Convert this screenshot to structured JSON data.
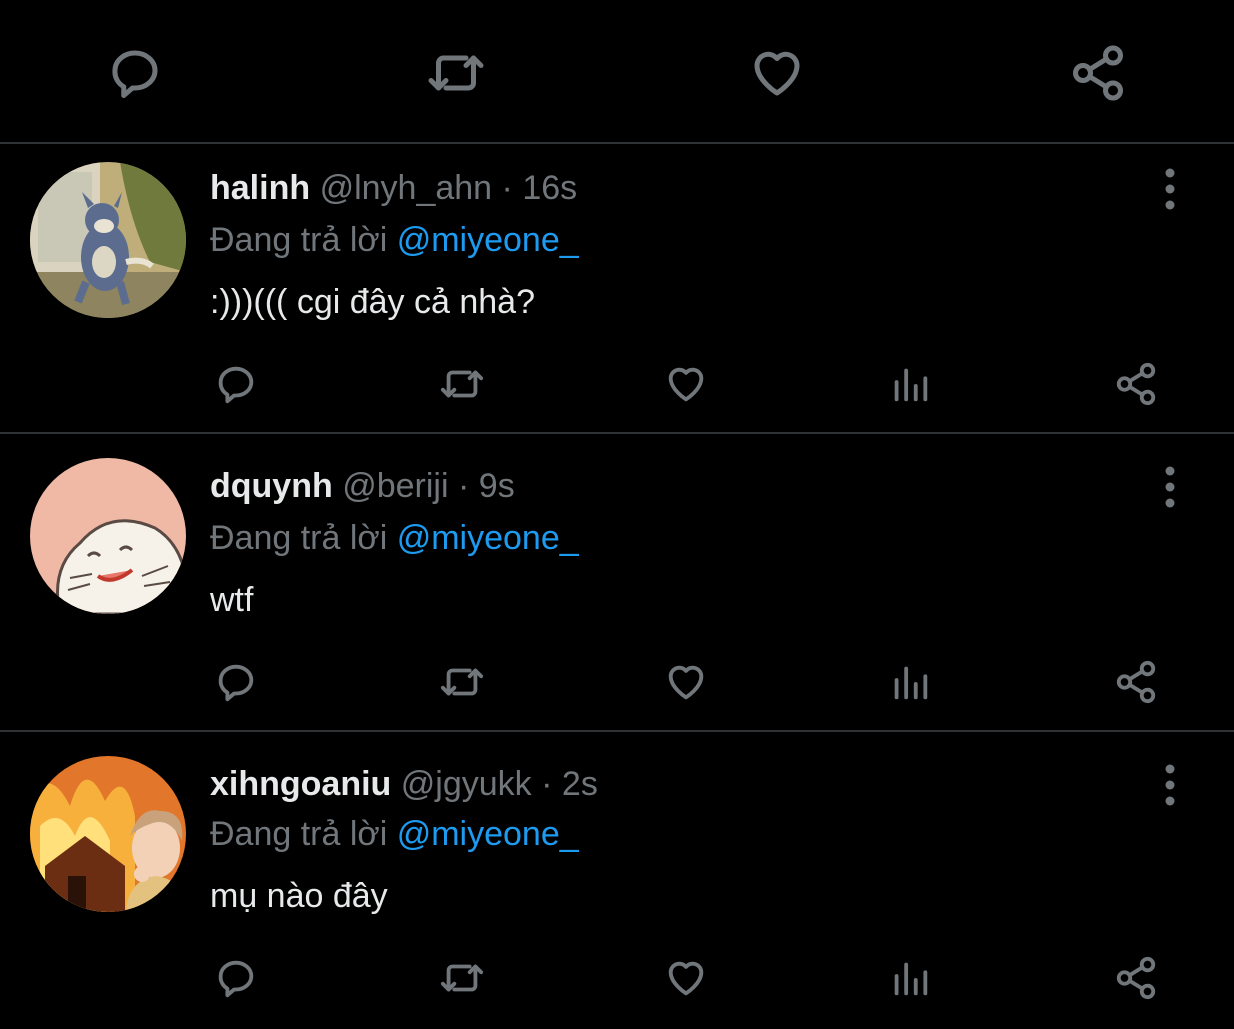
{
  "top_actions": {
    "icons": [
      "reply-icon",
      "retweet-icon",
      "like-icon",
      "share-icon"
    ]
  },
  "tweets": [
    {
      "name": "halinh",
      "handle": "@lnyh_ahn",
      "time": "16s",
      "separator": "·",
      "reply_prefix": "Đang trả lời",
      "reply_to": "@miyeone_",
      "text": ":)))((( cgi đây cả nhà?"
    },
    {
      "name": "dquynh",
      "handle": "@beriji",
      "time": "9s",
      "separator": "·",
      "reply_prefix": "Đang trả lời",
      "reply_to": "@miyeone_",
      "text": "wtf"
    },
    {
      "name": "xihngoaniu",
      "handle": "@jgyukk",
      "time": "2s",
      "separator": "·",
      "reply_prefix": "Đang trả lời",
      "reply_to": "@miyeone_",
      "text": "mụ nào đây"
    }
  ],
  "colors": {
    "background": "#000000",
    "divider": "#2f3336",
    "muted": "#71767b",
    "mention": "#1d9bf0",
    "text": "#e7e9ea"
  }
}
